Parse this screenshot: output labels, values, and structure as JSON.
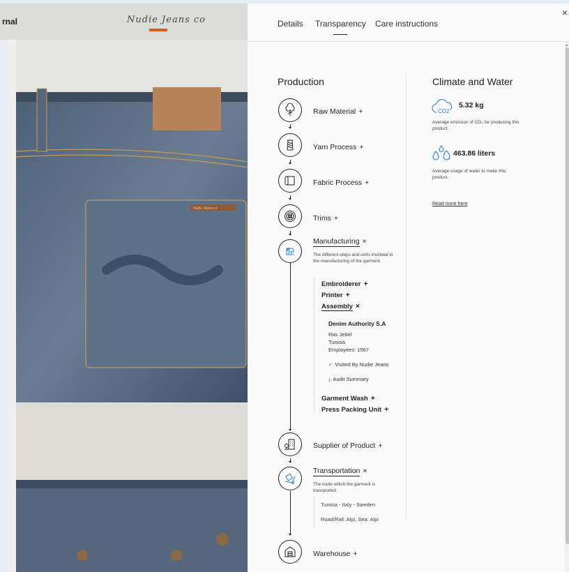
{
  "background": {
    "nav_text": "rnal",
    "logo_text": "Nudie Jeans co",
    "accent": "#e05a17",
    "patch_text": "Nudie Jeans co"
  },
  "tabs": [
    {
      "label": "Details"
    },
    {
      "label": "Transparency"
    },
    {
      "label": "Care instructions"
    }
  ],
  "close_label": "×",
  "production": {
    "title": "Production",
    "steps": [
      {
        "label": "Raw Material",
        "toggle": "+",
        "icon": "tree-icon"
      },
      {
        "label": "Yarn Process",
        "toggle": "+",
        "icon": "spool-icon"
      },
      {
        "label": "Fabric Process",
        "toggle": "+",
        "icon": "fabric-roll-icon"
      },
      {
        "label": "Trims",
        "toggle": "+",
        "icon": "button-icon"
      },
      {
        "label": "Manufacturing",
        "toggle": "×",
        "icon": "sewing-machine-icon",
        "description": "The different steps and units involved in the manufacturing of the garment."
      },
      {
        "label": "Supplier of Product",
        "toggle": "+",
        "icon": "building-icon"
      },
      {
        "label": "Transportation",
        "toggle": "×",
        "icon": "hand-truck-icon",
        "description": "The route which the garment is transported."
      },
      {
        "label": "Warehouse",
        "toggle": "+",
        "icon": "warehouse-icon"
      }
    ],
    "manufacturing_units": [
      {
        "label": "Embroiderer",
        "toggle": "+"
      },
      {
        "label": "Printer",
        "toggle": "+"
      },
      {
        "label": "Assembly",
        "toggle": "×"
      },
      {
        "label": "Garment Wash",
        "toggle": "+"
      },
      {
        "label": "Press Packing Unit",
        "toggle": "+"
      }
    ],
    "assembly": {
      "name": "Denim Authority S.A",
      "city": "Ras Jebel",
      "country": "Tunisia",
      "employees": "Employees: 1567",
      "visited": "Visited By Nudie Jeans",
      "audit": "Audit Summary"
    },
    "transport": {
      "route": "Tunisia - Italy - Sweden",
      "mode": "Road/Rail: Alpi, Sea: Alpi"
    }
  },
  "climate": {
    "title": "Climate and Water",
    "co2_value": "5.32 kg",
    "co2_label": "CO2",
    "co2_desc": "Average emission of CO₂ for producing this product.",
    "water_value": "463.86 liters",
    "water_desc": "Average usage of water to make this product.",
    "read_more": "Read more here"
  }
}
